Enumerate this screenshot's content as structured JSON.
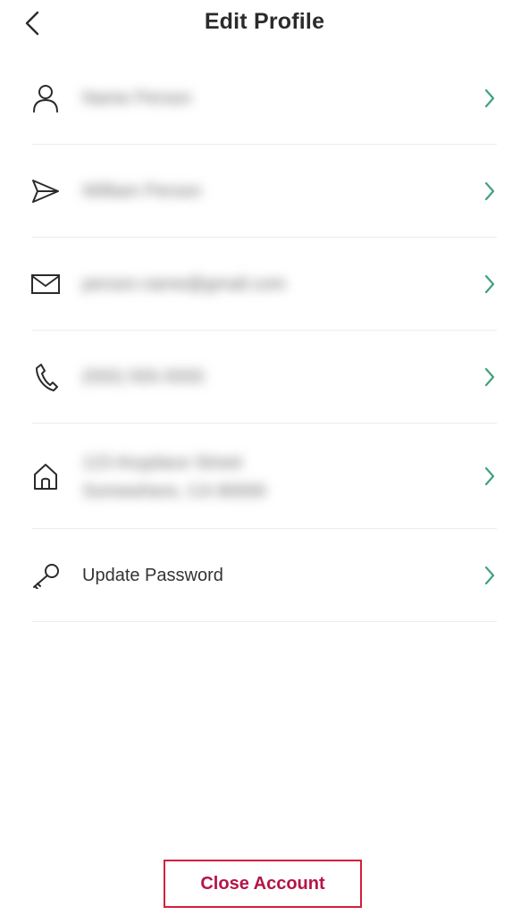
{
  "header": {
    "title": "Edit Profile",
    "back_icon": "chevron-left-icon"
  },
  "rows": [
    {
      "icon": "person-icon",
      "value": "Name Person"
    },
    {
      "icon": "send-icon",
      "value": "William Person"
    },
    {
      "icon": "mail-icon",
      "value": "person.name@gmail.com"
    },
    {
      "icon": "phone-icon",
      "value": "(555) 555-5555"
    },
    {
      "icon": "home-icon",
      "value": "123 Anyplace Street",
      "value2": "Somewhere, CA 90000"
    },
    {
      "icon": "key-icon",
      "value": "Update Password"
    }
  ],
  "footer": {
    "close_account_label": "Close Account"
  },
  "colors": {
    "chevron": "#3fa27a",
    "close_account_text": "#b51447",
    "close_account_border": "#d41f3c"
  }
}
